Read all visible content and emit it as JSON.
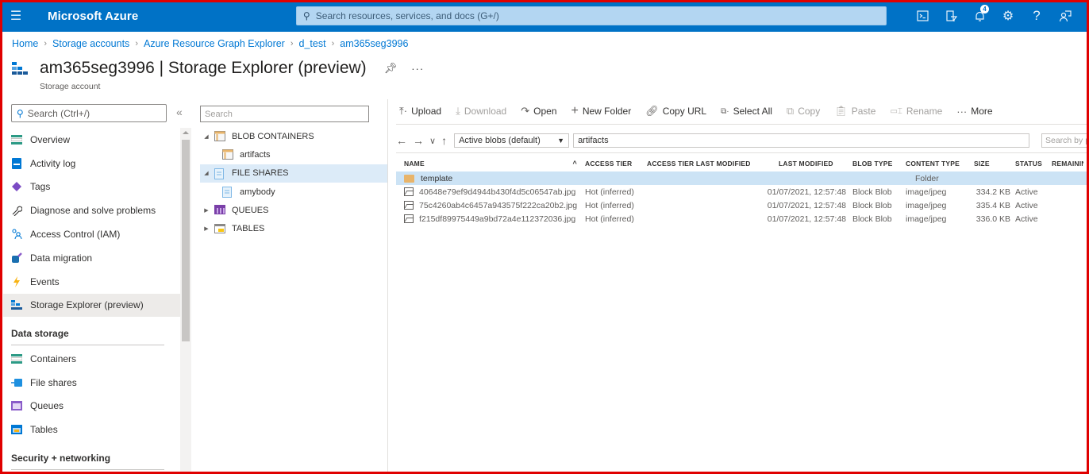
{
  "topbar": {
    "brand": "Microsoft Azure",
    "search_placeholder": "Search resources, services, and docs (G+/)",
    "notification_count": "4",
    "icons": [
      "cloud-shell-icon",
      "directory-filter-icon",
      "notifications-icon",
      "settings-icon",
      "help-icon",
      "feedback-icon"
    ]
  },
  "breadcrumb": [
    "Home",
    "Storage accounts",
    "Azure Resource Graph Explorer",
    "d_test",
    "am365seg3996"
  ],
  "header": {
    "title": "am365seg3996 | Storage Explorer (preview)",
    "subtitle": "Storage account",
    "more": "···"
  },
  "nav": {
    "search_placeholder": "Search (Ctrl+/)",
    "collapse": "«",
    "items": [
      {
        "label": "Overview",
        "icon": "overview-icon"
      },
      {
        "label": "Activity log",
        "icon": "activity-log-icon"
      },
      {
        "label": "Tags",
        "icon": "tag-icon"
      },
      {
        "label": "Diagnose and solve problems",
        "icon": "wrench-icon"
      },
      {
        "label": "Access Control (IAM)",
        "icon": "people-icon"
      },
      {
        "label": "Data migration",
        "icon": "data-migration-icon"
      },
      {
        "label": "Events",
        "icon": "lightning-icon"
      },
      {
        "label": "Storage Explorer (preview)",
        "icon": "storage-explorer-icon",
        "active": true
      }
    ],
    "section_data_storage": "Data storage",
    "data_storage_items": [
      {
        "label": "Containers",
        "icon": "containers-icon"
      },
      {
        "label": "File shares",
        "icon": "file-shares-icon"
      },
      {
        "label": "Queues",
        "icon": "queues-icon"
      },
      {
        "label": "Tables",
        "icon": "tables-icon"
      }
    ],
    "section_security": "Security + networking"
  },
  "tree": {
    "search_placeholder": "Search",
    "rows": [
      {
        "label": "BLOB CONTAINERS",
        "expanded": true,
        "level": 0
      },
      {
        "label": "artifacts",
        "level": 1
      },
      {
        "label": "FILE SHARES",
        "expanded": true,
        "level": 0,
        "selected": true
      },
      {
        "label": "amybody",
        "level": 1
      },
      {
        "label": "QUEUES",
        "expanded": false,
        "level": 0
      },
      {
        "label": "TABLES",
        "expanded": false,
        "level": 0
      }
    ]
  },
  "toolbar": {
    "upload": "Upload",
    "download": "Download",
    "open": "Open",
    "new_folder": "New Folder",
    "copy_url": "Copy URL",
    "select_all": "Select All",
    "copy": "Copy",
    "paste": "Paste",
    "rename": "Rename",
    "more": "More"
  },
  "address": {
    "blob_filter": "Active blobs (default)",
    "path": "artifacts",
    "search_placeholder": "Search by prefix"
  },
  "table": {
    "columns": [
      "NAME",
      "ACCESS TIER",
      "ACCESS TIER LAST MODIFIED",
      "LAST MODIFIED",
      "BLOB TYPE",
      "CONTENT TYPE",
      "SIZE",
      "STATUS",
      "REMAINING DAYS"
    ],
    "rows": [
      {
        "type": "folder",
        "name": "template",
        "tier": "",
        "tier_modified": "",
        "modified": "",
        "blob_type": "",
        "content_type": "Folder",
        "size": "",
        "status": "",
        "selected": true
      },
      {
        "type": "image",
        "name": "40648e79ef9d4944b430f4d5c06547ab.jpg",
        "tier": "Hot (inferred)",
        "tier_modified": "",
        "modified": "01/07/2021, 12:57:48",
        "blob_type": "Block Blob",
        "content_type": "image/jpeg",
        "size": "334.2 KB",
        "status": "Active"
      },
      {
        "type": "image",
        "name": "75c4260ab4c6457a943575f222ca20b2.jpg",
        "tier": "Hot (inferred)",
        "tier_modified": "",
        "modified": "01/07/2021, 12:57:48",
        "blob_type": "Block Blob",
        "content_type": "image/jpeg",
        "size": "335.4 KB",
        "status": "Active"
      },
      {
        "type": "image",
        "name": "f215df89975449a9bd72a4e112372036.jpg",
        "tier": "Hot (inferred)",
        "tier_modified": "",
        "modified": "01/07/2021, 12:57:48",
        "blob_type": "Block Blob",
        "content_type": "image/jpeg",
        "size": "336.0 KB",
        "status": "Active"
      }
    ]
  }
}
